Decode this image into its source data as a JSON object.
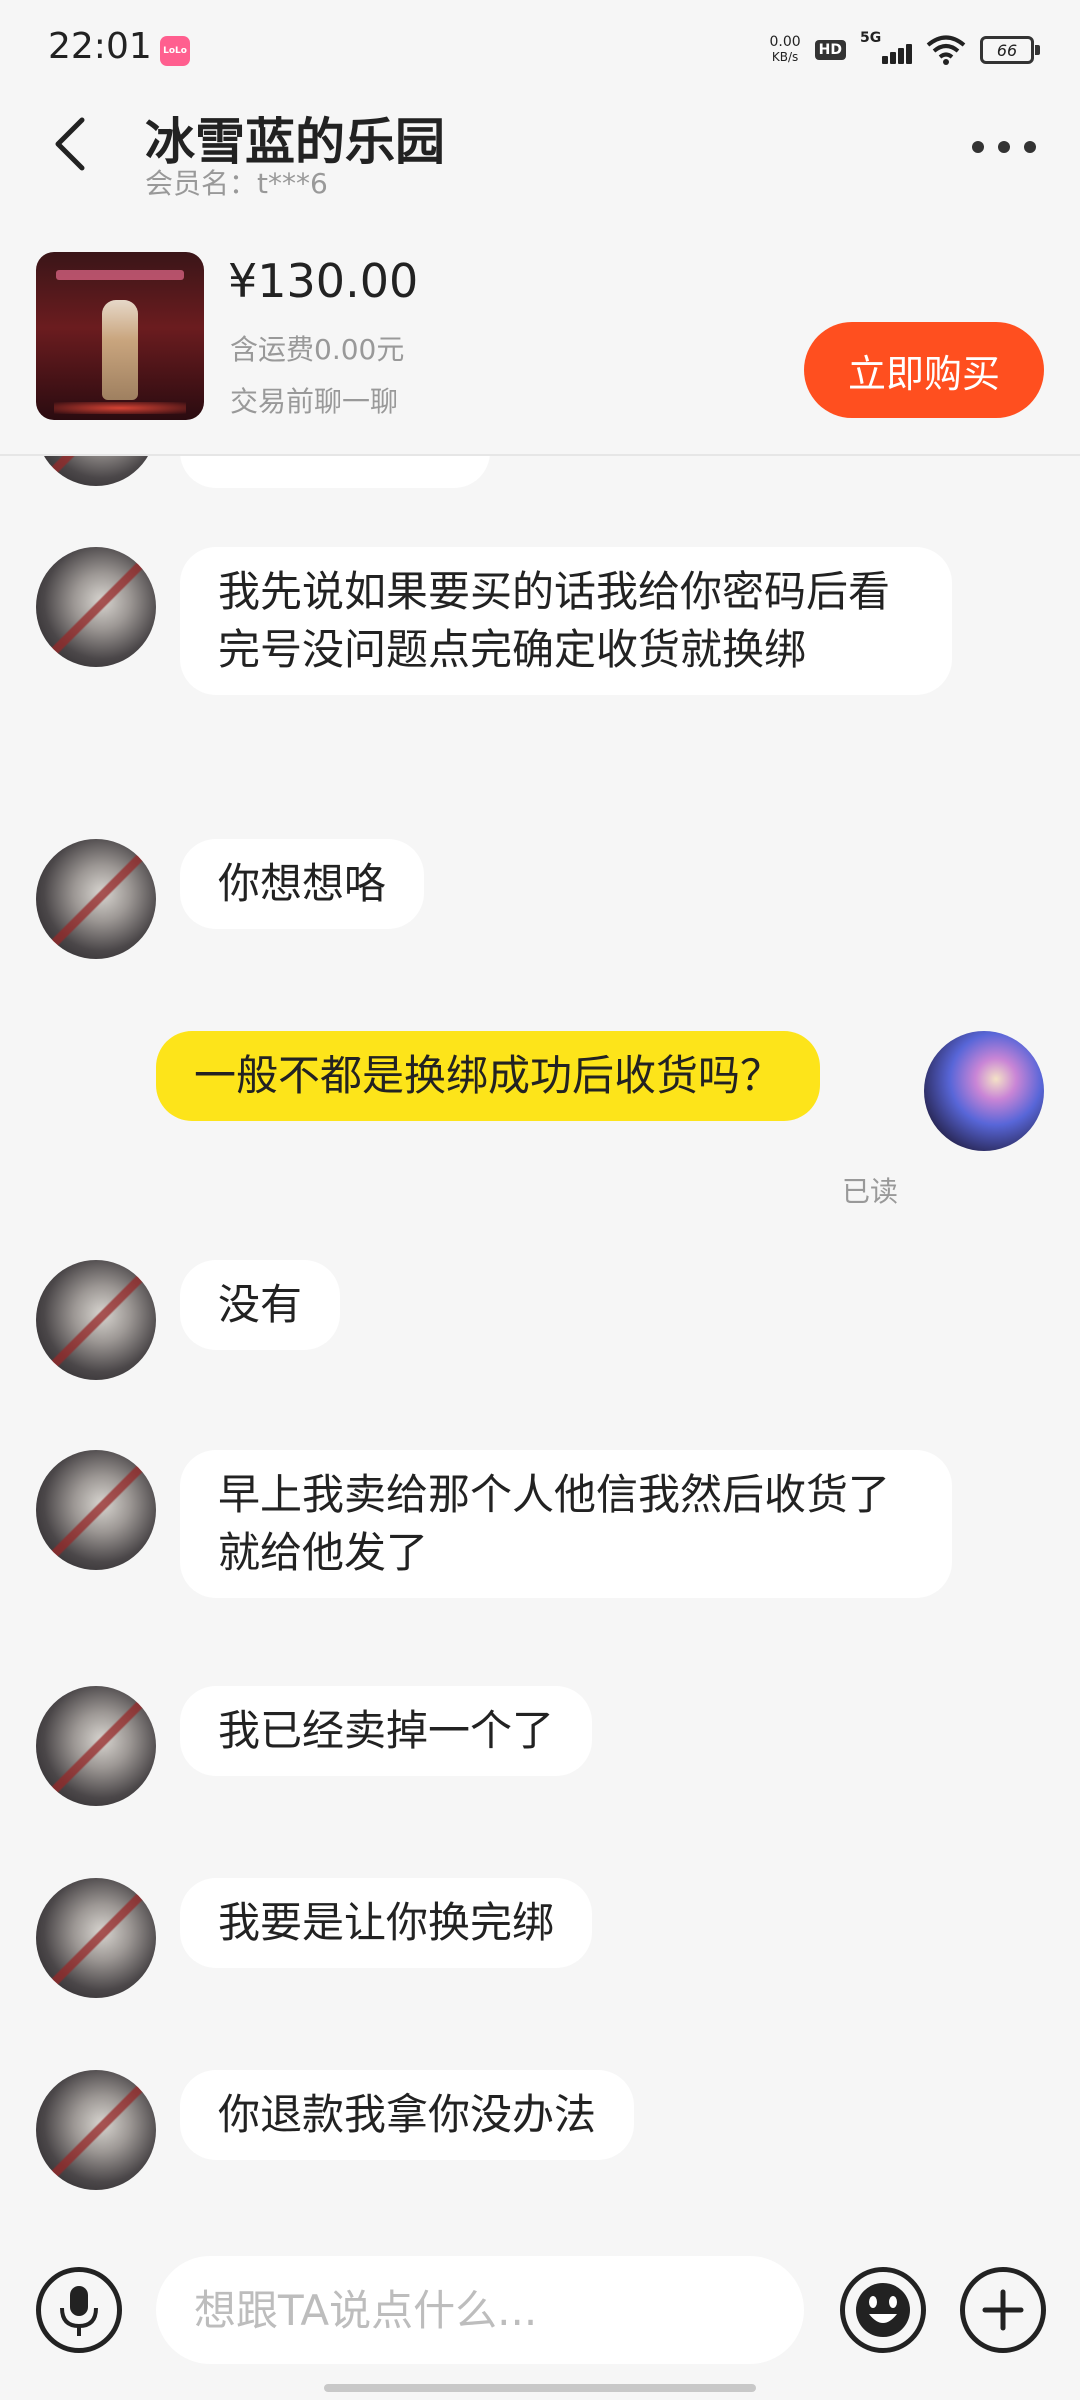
{
  "status_bar": {
    "time": "22:01",
    "app_badge": "LoLo",
    "net_speed_value": "0.00",
    "net_speed_unit": "KB/s",
    "hd": "HD",
    "network": "5G",
    "battery": "66"
  },
  "header": {
    "title": "冰雪蓝的乐园",
    "member": "会员名：t***6"
  },
  "product": {
    "price": "¥130.00",
    "shipping": "含运费0.00元",
    "chat_hint": "交易前聊一聊",
    "buy_label": "立即购买"
  },
  "messages": [
    {
      "from": "seller",
      "text": "我先说如果要买的话我给你密码后看完号没问题点完确定收货就换绑"
    },
    {
      "from": "seller",
      "text": "你想想咯"
    },
    {
      "from": "me",
      "text": "一般不都是换绑成功后收货吗？",
      "status": "已读"
    },
    {
      "from": "seller",
      "text": "没有"
    },
    {
      "from": "seller",
      "text": "早上我卖给那个人他信我然后收货了就给他发了"
    },
    {
      "from": "seller",
      "text": "我已经卖掉一个了"
    },
    {
      "from": "seller",
      "text": "我要是让你换完绑"
    },
    {
      "from": "seller",
      "text": "你退款我拿你没办法"
    }
  ],
  "input": {
    "placeholder": "想跟TA说点什么..."
  },
  "colors": {
    "buy_button": "#ff4f1f",
    "my_bubble": "#fde41a",
    "their_bubble": "#ffffff",
    "background": "#f6f6f6"
  },
  "icons": [
    "back-arrow-icon",
    "more-dots-icon",
    "microphone-icon",
    "emoji-icon",
    "plus-icon"
  ]
}
